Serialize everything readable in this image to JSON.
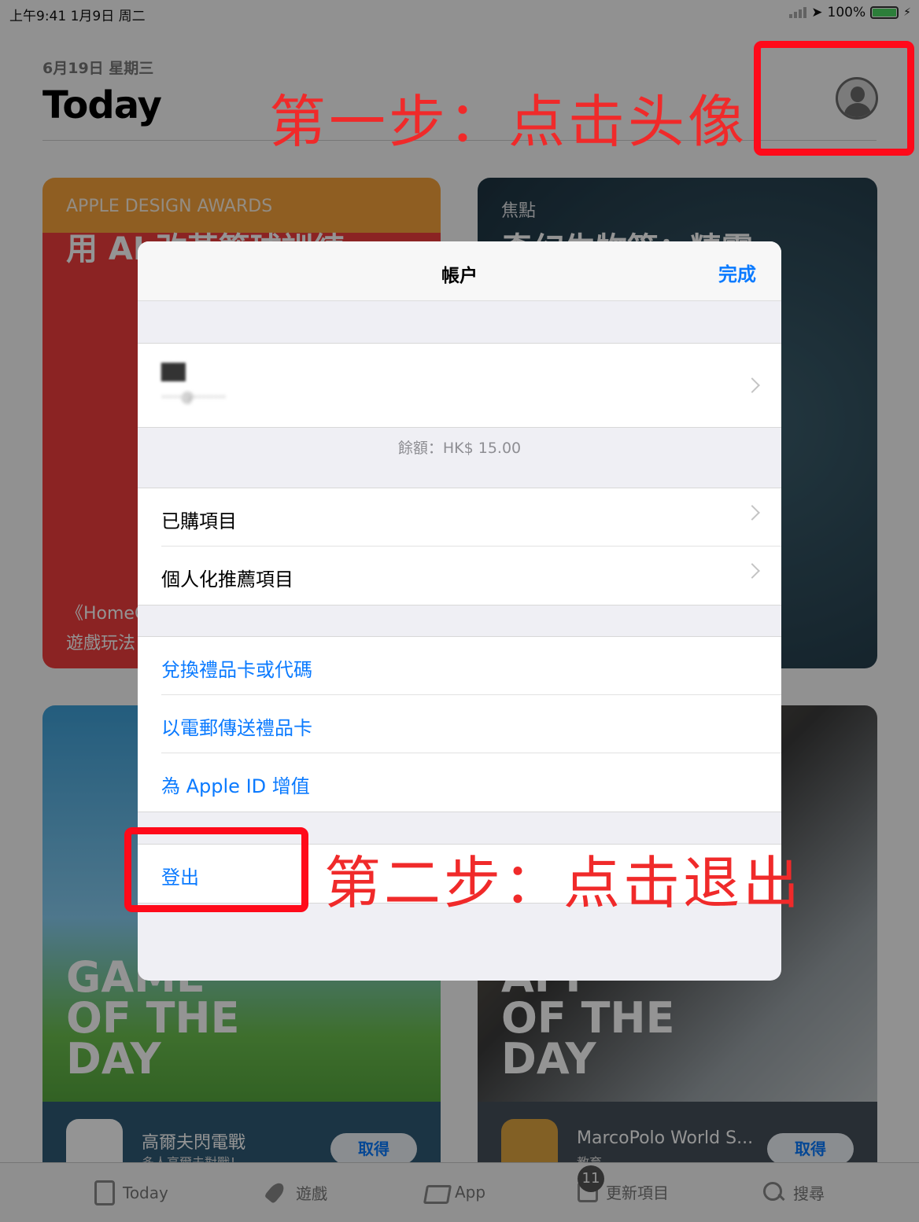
{
  "status_bar": {
    "time_date": "上午9:41   1月9日 周二",
    "battery": "100%"
  },
  "header": {
    "date": "6月19日 星期三",
    "title": "Today"
  },
  "cards": {
    "c1": {
      "kicker": "APPLE DESIGN AWARDS",
      "title": "用 AI 改革籃球訓練",
      "caption1": "《HomeCourt》",
      "caption2": "遊戲玩法"
    },
    "c2": {
      "kicker": "焦點",
      "title": "奇幻生物篇：精靈"
    },
    "c3": {
      "gotd": "GAME\nOF THE\nDAY",
      "app_name": "高爾夫閃電戰",
      "app_sub": "多人高爾夫對戰！",
      "get": "取得"
    },
    "c4": {
      "gotd": "APP\nOF THE\nDAY",
      "app_name": "MarcoPolo World S...",
      "app_sub": "教育",
      "get": "取得"
    }
  },
  "tabbar": {
    "today": "Today",
    "games": "遊戲",
    "apps": "App",
    "updates": "更新項目",
    "updates_badge": "11",
    "search": "搜尋"
  },
  "modal": {
    "title": "帳户",
    "done": "完成",
    "account_name": "██",
    "account_email": "·····@········",
    "balance": "餘額：HK$ 15.00",
    "rows_a": [
      "已購項目",
      "個人化推薦項目"
    ],
    "rows_b": [
      "兌換禮品卡或代碼",
      "以電郵傳送禮品卡",
      "為 Apple ID 增值"
    ],
    "sign_out": "登出"
  },
  "annotations": {
    "step1": "第一步：点击头像",
    "step2": "第二步：点击退出",
    "color": "#ff0a1a"
  }
}
